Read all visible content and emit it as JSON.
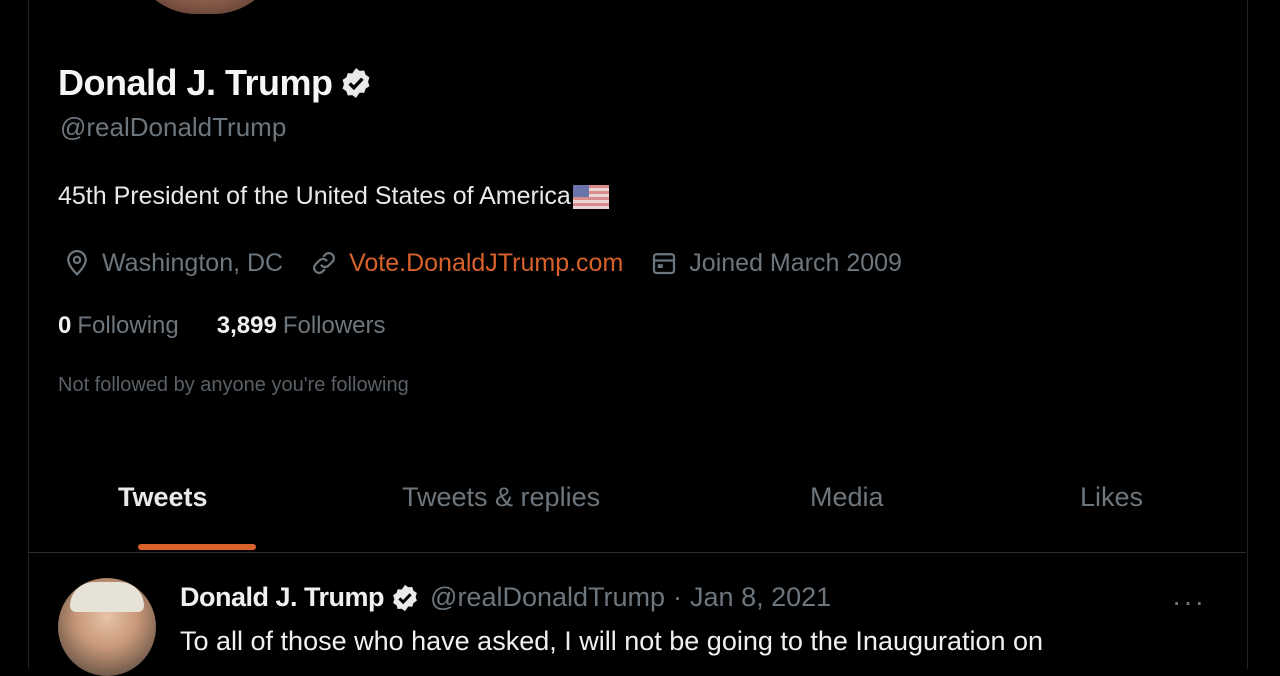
{
  "profile": {
    "display_name": "Donald J. Trump",
    "handle": "@realDonaldTrump",
    "bio": "45th President of the United States of America",
    "location": "Washington, DC",
    "website": "Vote.DonaldJTrump.com",
    "joined": "Joined March 2009",
    "following_count": "0",
    "following_label": "Following",
    "followers_count": "3,899",
    "followers_label": "Followers",
    "not_followed": "Not followed by anyone you're following"
  },
  "tabs": [
    {
      "label": "Tweets",
      "active": true
    },
    {
      "label": "Tweets & replies",
      "active": false
    },
    {
      "label": "Media",
      "active": false
    },
    {
      "label": "Likes",
      "active": false
    }
  ],
  "tweet": {
    "name": "Donald J. Trump",
    "handle": "@realDonaldTrump",
    "separator": "·",
    "date": "Jan 8, 2021",
    "more": "···",
    "text": "To all of those who have asked, I will not be going to the Inauguration on"
  },
  "colors": {
    "accent": "#d9622b",
    "background": "#000000",
    "muted": "#6e767d"
  },
  "icons": [
    "verified-badge-icon",
    "location-pin-icon",
    "link-icon",
    "calendar-icon",
    "more-icon"
  ]
}
